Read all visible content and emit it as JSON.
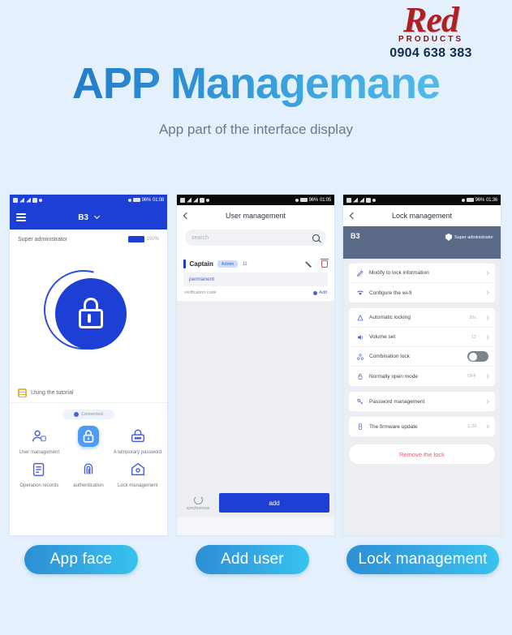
{
  "brand": {
    "word": "Red",
    "sub": "PRODUCTS",
    "phone": "0904 638 383"
  },
  "header": {
    "title": "APP Managemane",
    "subtitle": "App part of the interface display"
  },
  "colors": {
    "background": "#e4f0fb",
    "accent_blue": "#1d3fd4",
    "title_gradient_from": "#1a6fc4",
    "title_gradient_to": "#5fc5ef",
    "brand_red": "#b01f24",
    "pill_from": "#2c8fd4",
    "pill_to": "#37c3ef",
    "danger": "#f05a72",
    "banner": "#5b6b87"
  },
  "phone1": {
    "statusbar": {
      "time": "01:08",
      "battery": "96%",
      "style": "blue"
    },
    "header": {
      "title": "B3",
      "menu_icon": "hamburger-icon",
      "chevron": "chevron-down-icon"
    },
    "admin_label": "Super administrator",
    "battery_percent": "100%",
    "lock_icon": "lock-icon",
    "tutorial": {
      "label": "Using the tutorial",
      "icon": "book-icon"
    },
    "connected_chip": "Connected",
    "grid": [
      {
        "label": "User management",
        "icon": "user-management-icon",
        "active": false
      },
      {
        "label": "",
        "icon": "lock-icon",
        "active": true
      },
      {
        "label": "A temporary password",
        "icon": "temporary-password-icon",
        "active": false
      },
      {
        "label": "Operation records",
        "icon": "operation-records-icon",
        "active": false
      },
      {
        "label": "authentication",
        "icon": "authentication-icon",
        "active": false
      },
      {
        "label": "Lock management",
        "icon": "lock-management-icon",
        "active": false
      }
    ]
  },
  "phone2": {
    "statusbar": {
      "time": "01:05",
      "battery": "96%",
      "style": "dark"
    },
    "header": {
      "title": "User management",
      "back_icon": "back-arrow-icon"
    },
    "search": {
      "placeholder": "search",
      "icon": "search-icon"
    },
    "user": {
      "name": "Captain",
      "badge": "Admin",
      "count": "11",
      "edit_icon": "edit-pen-icon",
      "delete_icon": "trash-icon",
      "sub_label": "permanent",
      "sub_value": "",
      "meta_left": "verification code",
      "meta_right": "Add"
    },
    "footer": {
      "sync_label": "synchronous",
      "sync_icon": "refresh-icon",
      "add_label": "add"
    }
  },
  "phone3": {
    "statusbar": {
      "time": "01:36",
      "battery": "96%",
      "style": "dark"
    },
    "header": {
      "title": "Lock management",
      "back_icon": "back-arrow-icon"
    },
    "banner": {
      "name": "B3",
      "sub": "",
      "admin": "Super administrator",
      "admin_icon": "shield-icon"
    },
    "groups": [
      {
        "rows": [
          {
            "label": "Modify to lock information",
            "icon": "pen-icon",
            "value": "",
            "control": "chevron"
          },
          {
            "label": "Configure the wi-fi",
            "icon": "wifi-icon",
            "value": "",
            "control": "chevron"
          }
        ]
      },
      {
        "rows": [
          {
            "label": "Automatic locking",
            "icon": "auto-lock-icon",
            "value": "20s",
            "control": "chevron"
          },
          {
            "label": "Volume set",
            "icon": "volume-icon",
            "value": "12",
            "control": "chevron"
          },
          {
            "label": "Combination lock",
            "icon": "combination-lock-icon",
            "value": "",
            "control": "toggle"
          },
          {
            "label": "Normally open mode",
            "icon": "open-mode-icon",
            "value": "OFF",
            "control": "chevron"
          }
        ]
      },
      {
        "rows": [
          {
            "label": "Password management",
            "icon": "key-icon",
            "value": "",
            "control": "chevron"
          }
        ]
      },
      {
        "rows": [
          {
            "label": "The firmware update",
            "icon": "firmware-icon",
            "value": "1.33",
            "control": "chevron"
          }
        ]
      }
    ],
    "remove_label": "Remove the lock"
  },
  "captions": {
    "app_face": "App face",
    "add_user": "Add user",
    "lock_management": "Lock management"
  }
}
